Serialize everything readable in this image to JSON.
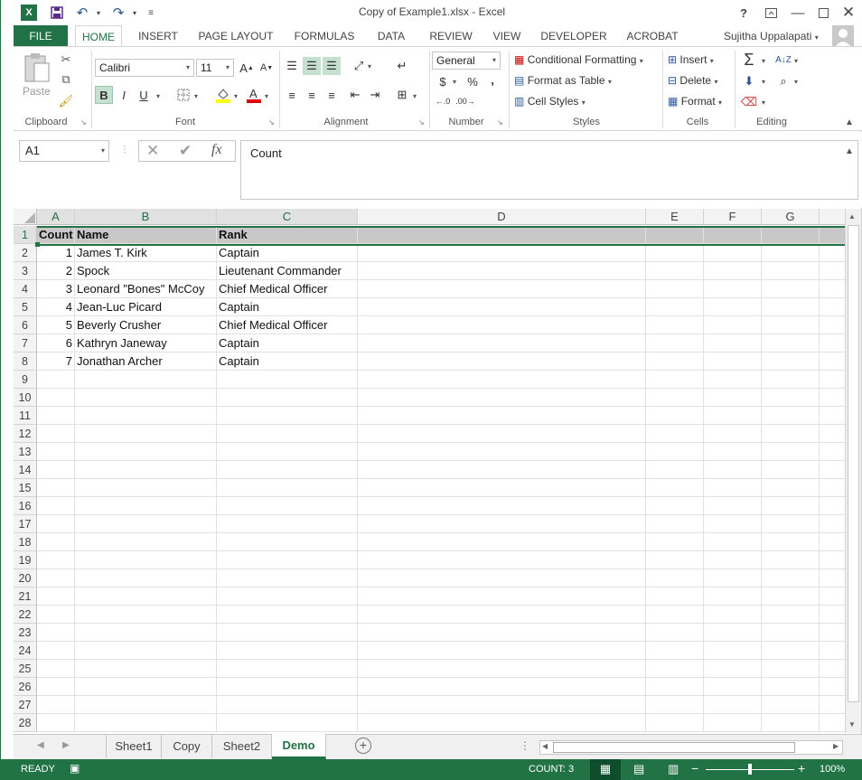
{
  "window": {
    "title": "Copy of Example1.xlsx - Excel",
    "help": "?",
    "user": "Sujitha Uppalapati"
  },
  "tabs": [
    "FILE",
    "HOME",
    "INSERT",
    "PAGE LAYOUT",
    "FORMULAS",
    "DATA",
    "REVIEW",
    "VIEW",
    "DEVELOPER",
    "ACROBAT"
  ],
  "ribbon": {
    "clipboard": {
      "label": "Clipboard",
      "paste": "Paste"
    },
    "font": {
      "label": "Font",
      "name": "Calibri",
      "size": "11",
      "bold": "B",
      "italic": "I",
      "underline": "U"
    },
    "alignment": {
      "label": "Alignment"
    },
    "number": {
      "label": "Number",
      "format": "General",
      "currency": "$",
      "percent": "%",
      "comma": ","
    },
    "styles": {
      "label": "Styles",
      "conditional": "Conditional Formatting",
      "format_table": "Format as Table",
      "cell_styles": "Cell Styles"
    },
    "cells": {
      "label": "Cells",
      "insert": "Insert",
      "delete": "Delete",
      "format": "Format"
    },
    "editing": {
      "label": "Editing"
    }
  },
  "formula_bar": {
    "name_box": "A1",
    "fx": "fx",
    "value": "Count"
  },
  "columns": [
    "A",
    "B",
    "C",
    "D",
    "E",
    "F",
    "G"
  ],
  "rows": [
    [
      "Count",
      "Name",
      "Rank"
    ],
    [
      "1",
      "James T. Kirk",
      "Captain"
    ],
    [
      "2",
      "Spock",
      "Lieutenant Commander"
    ],
    [
      "3",
      "Leonard \"Bones\" McCoy",
      "Chief Medical Officer"
    ],
    [
      "4",
      "Jean-Luc Picard",
      "Captain"
    ],
    [
      "5",
      "Beverly Crusher",
      "Chief Medical Officer"
    ],
    [
      "6",
      "Kathryn Janeway",
      "Captain"
    ],
    [
      "7",
      "Jonathan Archer",
      "Captain"
    ]
  ],
  "row_numbers": [
    "1",
    "2",
    "3",
    "4",
    "5",
    "6",
    "7",
    "8",
    "9",
    "10",
    "11",
    "12",
    "13",
    "14",
    "15",
    "16",
    "17",
    "18",
    "19",
    "20",
    "21",
    "22",
    "23",
    "24",
    "25",
    "26",
    "27",
    "28"
  ],
  "sheets": [
    "Sheet1",
    "Copy",
    "Sheet2",
    "Demo"
  ],
  "active_sheet": "Demo",
  "status": {
    "ready": "READY",
    "count": "COUNT: 3",
    "zoom": "100%"
  },
  "colors": {
    "accent": "#217346",
    "header_fill": "#c8c8c8"
  }
}
